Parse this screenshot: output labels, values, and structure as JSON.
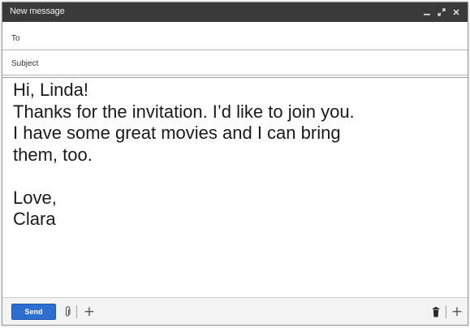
{
  "window": {
    "title": "New message"
  },
  "fields": {
    "to_label": "To",
    "to_value": "",
    "subject_label": "Subject",
    "subject_value": ""
  },
  "message": {
    "lines": [
      "Hi, Linda!",
      "Thanks for the invitation. I’d like to join you.",
      "I have some great movies and I can bring",
      "them, too.",
      "",
      "Love,",
      "Clara"
    ]
  },
  "toolbar": {
    "send_label": "Send",
    "insert_symbol": "+",
    "more_symbol": "+"
  },
  "icons": {
    "minimize": "minimize-icon",
    "expand": "expand-icon",
    "close": "close-icon",
    "attach": "paperclip-icon",
    "discard": "trash-icon"
  },
  "colors": {
    "titlebar": "#3a3a3a",
    "send_button": "#2c6fd1"
  }
}
